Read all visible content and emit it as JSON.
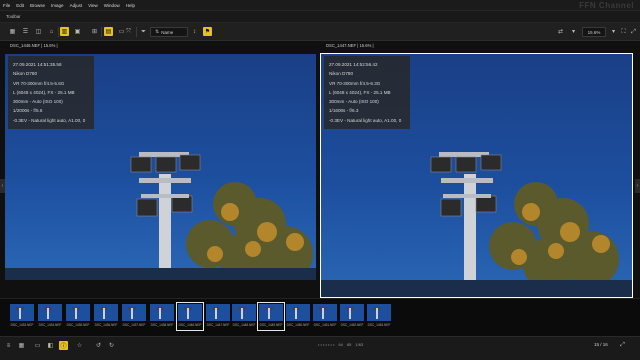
{
  "app": {
    "watermark": "FFN Channel"
  },
  "menu": {
    "items": [
      "File",
      "Edit",
      "Browse",
      "Image",
      "Adjust",
      "View",
      "Window",
      "Help"
    ]
  },
  "panel": {
    "title": "Toolbar"
  },
  "toolbar": {
    "sort_value": "Name",
    "zoom_value": "15.6%",
    "accent_color": "#e6c224"
  },
  "viewer": {
    "left": {
      "filename": "DSC_1446.NEF | 15.6% |",
      "info": [
        "27.09.2021 14:51:35.58",
        "Nikon D780",
        "VR 70-300mm f/4.5-5.6G",
        "L (6048 x 4024), FX - 25.1 MB",
        "300mm - Auto (ISO 100)",
        "1/2000s - f/5.6",
        "-0.3EV - Natural light auto, A1.00, 0"
      ]
    },
    "right": {
      "filename": "DSC_1447.NEF | 15.6% |",
      "info": [
        "27.09.2021 14:52:56.42",
        "Nikon D780",
        "VR 70-300mm f/4.5-6.3G",
        "L (6048 x 4024), FX - 25.1 MB",
        "300mm - Auto (ISO 100)",
        "1/1600s - f/6.3",
        "-0.3EV - Natural light auto, A1.00, 0"
      ]
    }
  },
  "filmstrip": {
    "thumbs": [
      "DSC_1433.NEF",
      "DSC_1434.NEF",
      "DSC_1435.NEF",
      "DSC_1436.NEF",
      "DSC_1437.NEF",
      "DSC_1438.NEF",
      "DSC_1446.NEF",
      "DSC_1447.NEF",
      "DSC_1448.NEF",
      "DSC_1449.NEF",
      "DSC_1450.NEF",
      "DSC_1451.NEF",
      "DSC_1452.NEF",
      "DSC_1453.NEF"
    ],
    "selected": [
      "DSC_1446.NEF",
      "DSC_1449.NEF"
    ]
  },
  "status": {
    "pager": [
      "• • • • • • •",
      "64",
      "65",
      "1/63"
    ],
    "counter": "15 / 16"
  },
  "icons": {
    "toolbar_left": [
      "grid-icon",
      "list-icon",
      "preview-icon",
      "map-icon",
      "panel-icon",
      "compare-icon",
      "fit-icon",
      "hide-icon",
      "filter-icon",
      "sort-icon",
      "sort-order-icon",
      "flag-icon"
    ],
    "toolbar_right": [
      "swap-icon",
      "sync-icon",
      "options-icon",
      "zoom-out-icon",
      "zoom-in-icon",
      "fullscreen-icon"
    ],
    "status_left": [
      "menu-icon",
      "layout-icon",
      "rating-icon",
      "label-icon",
      "info-icon",
      "rotate-left-icon",
      "rotate-right-icon"
    ]
  },
  "colors": {
    "sky": "#1c4d9c",
    "frame": "#ffffff"
  }
}
